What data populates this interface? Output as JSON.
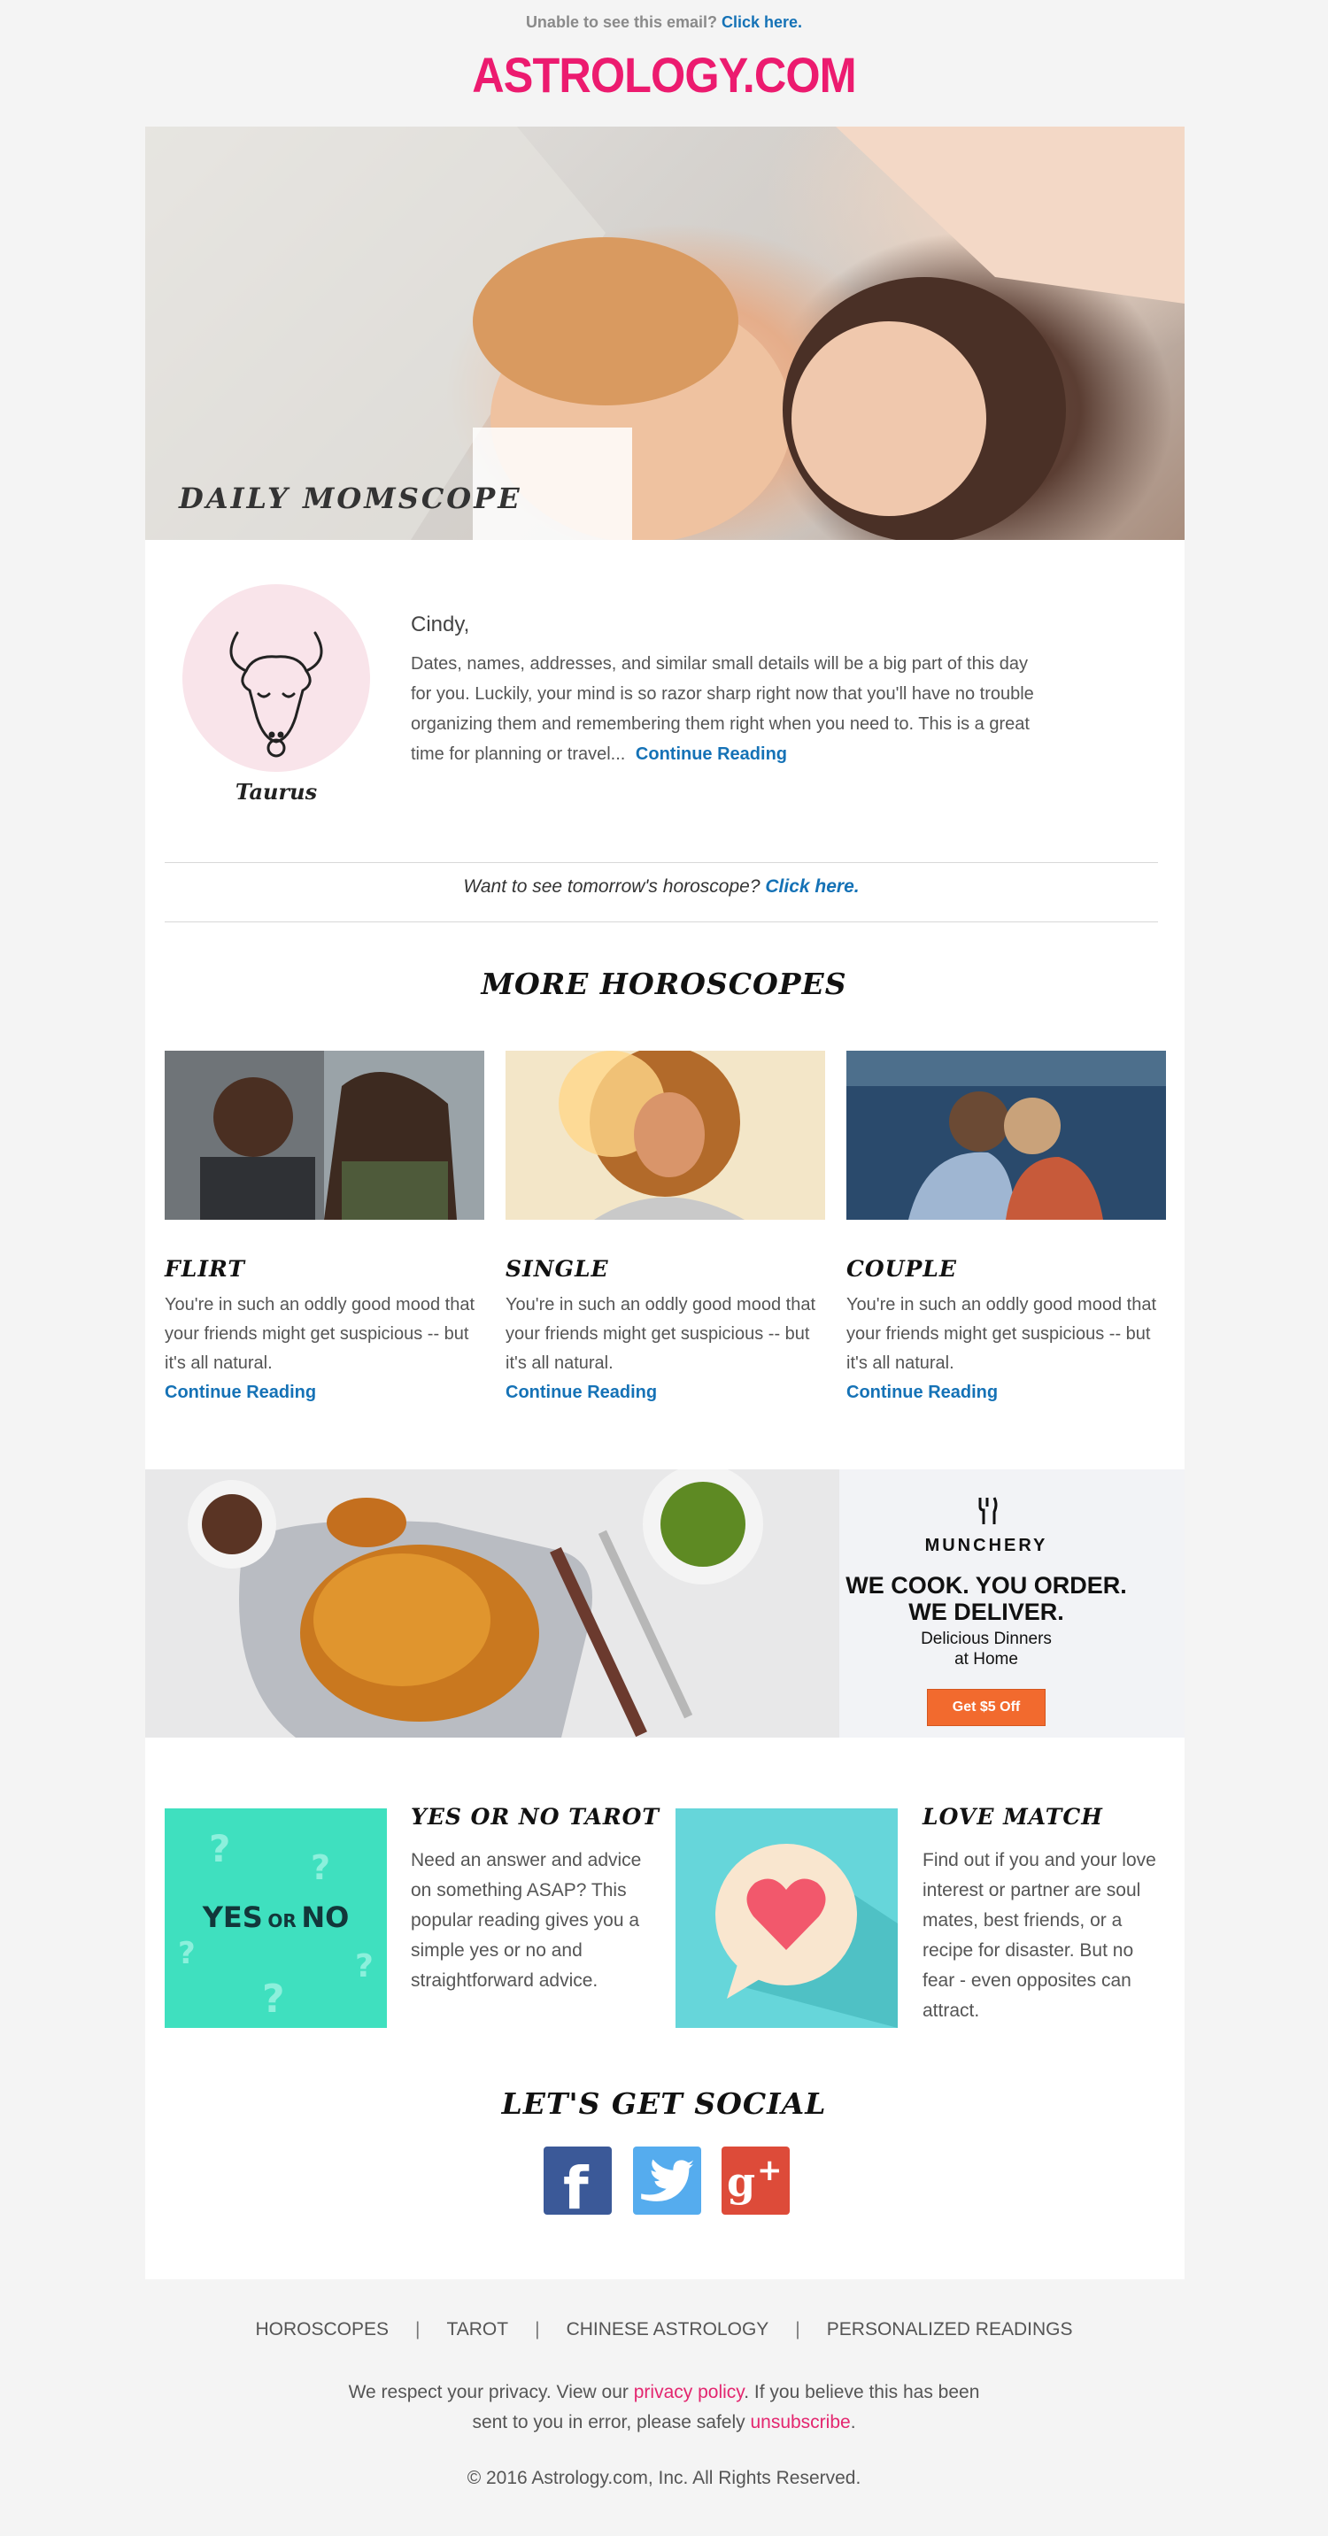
{
  "preheader": {
    "text": "Unable to see this email?",
    "link": "Click here."
  },
  "logo": "ASTROLOGY.COM",
  "hero": {
    "title": "DAILY MOMSCOPE"
  },
  "daily": {
    "sign": "Taurus",
    "greeting": "Cindy,",
    "text": "Dates, names, addresses, and similar small details will be a big part of this day for you. Luckily, your mind is so razor sharp right now that you'll have no trouble organizing them and remembering them right when you need to. This is a great time for planning or travel...",
    "link": "Continue Reading"
  },
  "tomorrow": {
    "text": "Want to see tomorrow's horoscope?",
    "link": "Click here."
  },
  "more": {
    "title": "MORE HOROSCOPES",
    "items": [
      {
        "title": "FLIRT",
        "text": "You're in such an oddly good mood that your friends might get suspicious -- but it's all natural.",
        "link": "Continue Reading"
      },
      {
        "title": "SINGLE",
        "text": "You're in such an oddly good mood that your friends might get suspicious -- but it's all natural.",
        "link": "Continue Reading"
      },
      {
        "title": "COUPLE",
        "text": "You're in such an oddly good mood that your friends might get suspicious -- but it's all natural.",
        "link": "Continue Reading"
      }
    ]
  },
  "ad": {
    "brand": "MUNCHERY",
    "headline_1": "WE COOK. YOU ORDER.",
    "headline_2": "WE DELIVER.",
    "sub_1": "Delicious Dinners",
    "sub_2": "at Home",
    "button": "Get $5 Off",
    "button_color": "#f26a2e"
  },
  "features": [
    {
      "title": "YES OR NO TAROT",
      "text": "Need an answer and advice on something ASAP? This popular reading gives you a simple yes or no and straightforward advice.",
      "tile_yes": "YES",
      "tile_or": "OR",
      "tile_no": "NO",
      "tile_color": "#3fe0bf"
    },
    {
      "title": "LOVE MATCH",
      "text": "Find out if you and your love interest or partner are soul mates, best friends, or a recipe for disaster. But no fear - even opposites can attract.",
      "tile_color": "#66d6da"
    }
  ],
  "social": {
    "title": "LET'S GET SOCIAL",
    "icons": [
      "facebook-icon",
      "twitter-icon",
      "google-plus-icon"
    ],
    "colors": {
      "facebook": "#3b5998",
      "twitter": "#55acee",
      "google": "#dd4b39"
    }
  },
  "footer": {
    "nav": [
      "HOROSCOPES",
      "TAROT",
      "CHINESE ASTROLOGY",
      "PERSONALIZED READINGS"
    ],
    "privacy_1": "We respect your privacy. View our",
    "privacy_link": "privacy policy",
    "privacy_2": ". If you believe this has been",
    "privacy_3": "sent to you in error, please safely",
    "unsubscribe": "unsubscribe",
    "copyright": "© 2016 Astrology.com, Inc. All Rights Reserved."
  },
  "colors": {
    "brand_pink": "#ec1b6f",
    "link_blue": "#1572b6"
  }
}
